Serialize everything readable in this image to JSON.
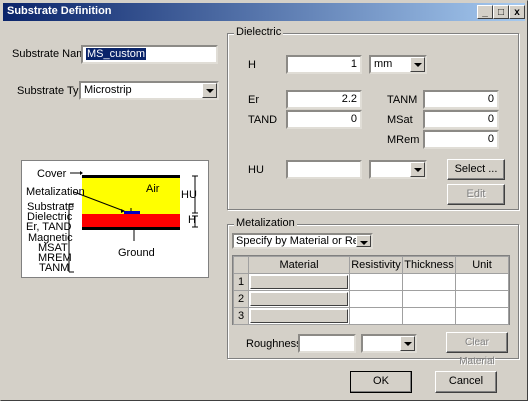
{
  "window": {
    "title": "Substrate Definition",
    "min": "_",
    "max": "□",
    "close": "x"
  },
  "substrate_name": {
    "label": "Substrate Name:",
    "value": "MS_custom"
  },
  "substrate_type": {
    "label": "Substrate Type:",
    "value": "Microstrip"
  },
  "diagram": {
    "cover": "Cover",
    "metalization": "Metalization",
    "air": "Air",
    "substrate": "Substrate",
    "dielectric": "Dielectric",
    "er_tand": "Er, TAND",
    "magnetic": "Magnetic",
    "msat": "MSAT",
    "mrem": "MREM",
    "tanm": "TANM",
    "ground": "Ground",
    "hu": "HU",
    "h": "H"
  },
  "dielectric": {
    "legend": "Dielectric",
    "h_label": "H",
    "h_value": "1",
    "h_unit": "mm",
    "er_label": "Er",
    "er_value": "2.2",
    "tanm_label": "TANM",
    "tanm_value": "0",
    "tand_label": "TAND",
    "tand_value": "0",
    "msat_label": "MSat",
    "msat_value": "0",
    "mrem_label": "MRem",
    "mrem_value": "0",
    "hu_label": "HU",
    "hu_value": "",
    "hu_unit": "",
    "select_label": "Select ...",
    "edit_label": "Edit"
  },
  "metalization": {
    "legend": "Metalization",
    "mode": "Specify by Material or Resistivity",
    "columns": [
      "Material",
      "Resistivity",
      "Thickness",
      "Unit"
    ],
    "rows": [
      "1",
      "2",
      "3"
    ],
    "roughness_label": "Roughness:",
    "roughness_value": "",
    "roughness_unit": "",
    "clear_label": "Clear Material"
  },
  "footer": {
    "ok": "OK",
    "cancel": "Cancel"
  },
  "colors": {
    "air": "#ffff00",
    "dielectric": "#ff0000",
    "metal": "#0000c0",
    "title_start": "#0a246a",
    "title_end": "#a6caf0"
  }
}
